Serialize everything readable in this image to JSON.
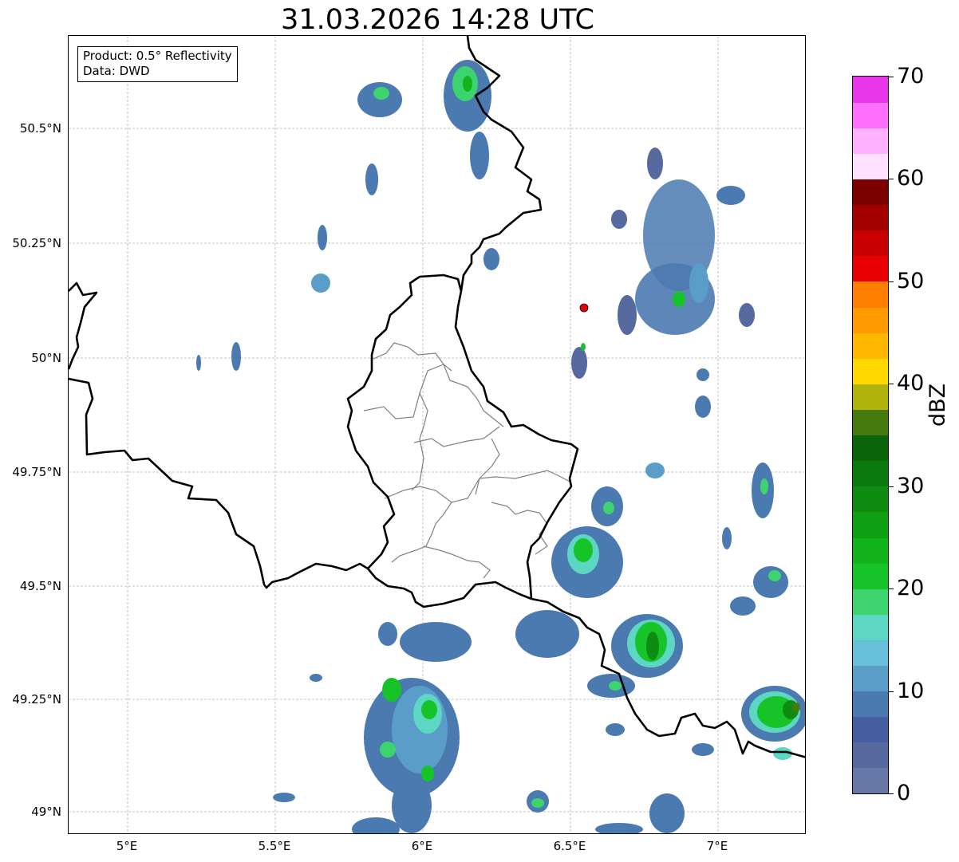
{
  "title": "31.03.2026 14:28 UTC",
  "info": {
    "product": "Product: 0.5° Reflectivity",
    "data": "Data: DWD"
  },
  "axes": {
    "y_ticks": [
      "50.5°N",
      "50.25°N",
      "50°N",
      "49.75°N",
      "49.5°N",
      "49.25°N",
      "49°N"
    ],
    "x_ticks": [
      "5°E",
      "5.5°E",
      "6°E",
      "6.5°E",
      "7°E"
    ],
    "lon_range": [
      4.8,
      7.3
    ],
    "lat_range": [
      48.95,
      50.7
    ]
  },
  "radar_site": {
    "name": "radar-site",
    "lon": 6.55,
    "lat": 50.11,
    "color": "#e8000b"
  },
  "colorbar": {
    "unit": "dBZ",
    "min": 0,
    "max": 70,
    "labels": [
      "70",
      "60",
      "50",
      "40",
      "30",
      "20",
      "10",
      "0"
    ],
    "colors_low_to_high": [
      "#6578a8",
      "#566aa0",
      "#445ea0",
      "#4b7ab0",
      "#5a9dc8",
      "#66c0da",
      "#5ed6c4",
      "#3dd470",
      "#16c42a",
      "#12b41c",
      "#10a014",
      "#0d8c10",
      "#0b7a0e",
      "#0a640a",
      "#467a0e",
      "#b0b40a",
      "#ffd800",
      "#ffb800",
      "#ff9a00",
      "#ff7e00",
      "#e80000",
      "#c80000",
      "#a40000",
      "#7d0000",
      "#ffe0ff",
      "#ffb2ff",
      "#ff6eff",
      "#e836e8"
    ]
  },
  "colors": {
    "border_country": "#000000",
    "border_region": "#808080",
    "grid": "#b4b4b4"
  }
}
